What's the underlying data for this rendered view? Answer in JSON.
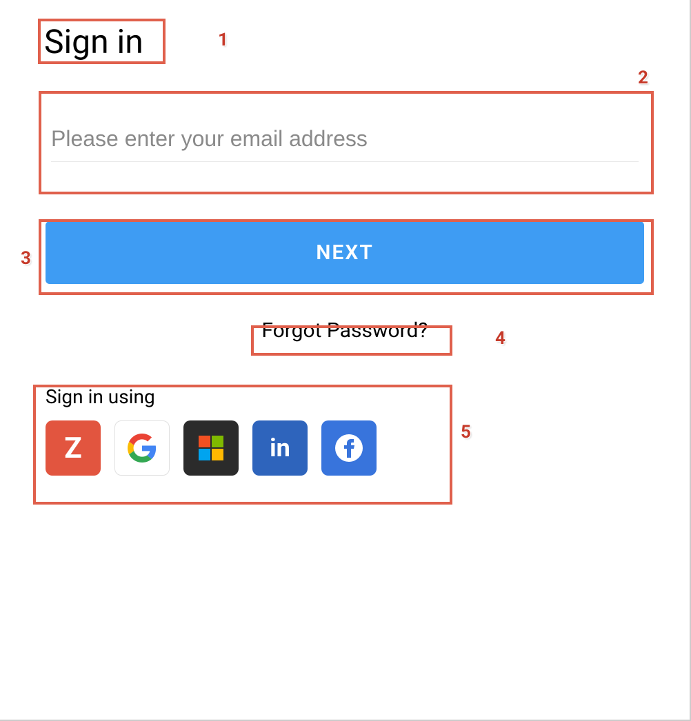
{
  "page": {
    "title": "Sign in"
  },
  "form": {
    "email_placeholder": "Please enter your email address",
    "email_value": "",
    "next_button_label": "NEXT",
    "forgot_password_label": "Forgot Password?"
  },
  "social": {
    "heading": "Sign in using",
    "providers": [
      {
        "id": "zoho",
        "name": "Zoho"
      },
      {
        "id": "google",
        "name": "Google"
      },
      {
        "id": "microsoft",
        "name": "Microsoft"
      },
      {
        "id": "linkedin",
        "name": "LinkedIn"
      },
      {
        "id": "facebook",
        "name": "Facebook"
      }
    ]
  },
  "annotations": {
    "1": "1",
    "2": "2",
    "3": "3",
    "4": "4",
    "5": "5"
  }
}
